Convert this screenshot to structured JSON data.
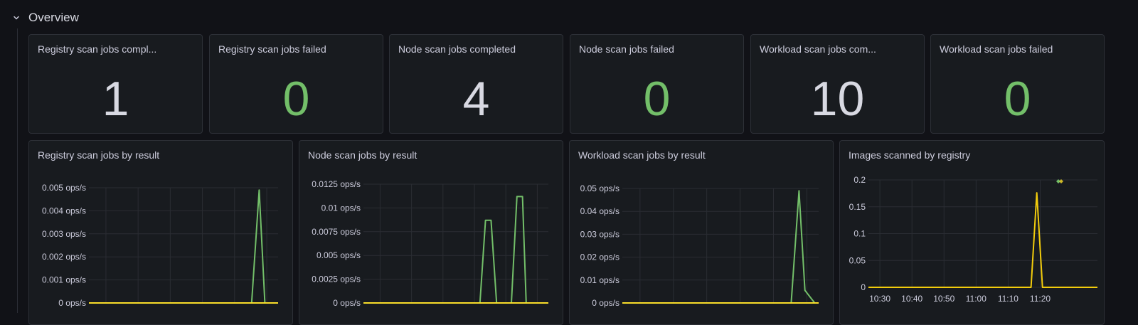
{
  "row": {
    "title": "Overview",
    "icon": "chevron-down-icon"
  },
  "stats": [
    {
      "title": "Registry scan jobs compl...",
      "value": "1",
      "color": "#d8d9e2"
    },
    {
      "title": "Registry scan jobs failed",
      "value": "0",
      "color": "#73bf69"
    },
    {
      "title": "Node scan jobs completed",
      "value": "4",
      "color": "#d8d9e2"
    },
    {
      "title": "Node scan jobs failed",
      "value": "0",
      "color": "#73bf69"
    },
    {
      "title": "Workload scan jobs com...",
      "value": "10",
      "color": "#d8d9e2"
    },
    {
      "title": "Workload scan jobs failed",
      "value": "0",
      "color": "#73bf69"
    }
  ],
  "chart_data": [
    {
      "type": "line",
      "title": "Registry scan jobs by result",
      "y_ticks": [
        "0 ops/s",
        "0.001 ops/s",
        "0.002 ops/s",
        "0.003 ops/s",
        "0.004 ops/s",
        "0.005 ops/s"
      ],
      "ylim": [
        0,
        0.005
      ],
      "x": [
        0,
        0.86,
        0.9,
        0.93,
        1
      ],
      "series": [
        {
          "color": "#73bf69",
          "values": [
            0,
            0,
            0.0049,
            0,
            0
          ]
        },
        {
          "color": "#fade2a",
          "values": [
            0,
            0,
            0,
            0,
            0
          ]
        }
      ]
    },
    {
      "type": "line",
      "title": "Node scan jobs by result",
      "y_ticks": [
        "0 ops/s",
        "0.0025 ops/s",
        "0.005 ops/s",
        "0.0075 ops/s",
        "0.01 ops/s",
        "0.0125 ops/s"
      ],
      "ylim": [
        0,
        0.0125
      ],
      "x": [
        0,
        0.63,
        0.66,
        0.69,
        0.72,
        0.8,
        0.83,
        0.86,
        0.88,
        1
      ],
      "series": [
        {
          "color": "#73bf69",
          "values": [
            0,
            0,
            0.0087,
            0.0087,
            0,
            0,
            0.0112,
            0.0112,
            0,
            0
          ]
        },
        {
          "color": "#fade2a",
          "values": [
            0,
            0,
            0,
            0,
            0,
            0,
            0,
            0,
            0,
            0
          ]
        }
      ]
    },
    {
      "type": "line",
      "title": "Workload scan jobs by result",
      "y_ticks": [
        "0 ops/s",
        "0.01 ops/s",
        "0.02 ops/s",
        "0.03 ops/s",
        "0.04 ops/s",
        "0.05 ops/s"
      ],
      "ylim": [
        0,
        0.05
      ],
      "x": [
        0,
        0.86,
        0.9,
        0.93,
        0.98,
        1
      ],
      "series": [
        {
          "color": "#73bf69",
          "values": [
            0,
            0,
            0.049,
            0.0055,
            0,
            0
          ]
        },
        {
          "color": "#fade2a",
          "values": [
            0,
            0,
            0,
            0,
            0,
            0
          ]
        }
      ]
    },
    {
      "type": "line",
      "title": "Images scanned by registry",
      "y_ticks": [
        "0",
        "0.05",
        "0.1",
        "0.15",
        "0.2"
      ],
      "ylim": [
        0,
        0.2
      ],
      "x_ticks": [
        "10:30",
        "10:40",
        "10:50",
        "11:00",
        "11:10",
        "11:20"
      ],
      "x_tick_pos": [
        0.05,
        0.19,
        0.33,
        0.47,
        0.61,
        0.75
      ],
      "x": [
        0,
        0.71,
        0.735,
        0.76,
        1
      ],
      "series": [
        {
          "color": "#f2cc0c",
          "values": [
            0,
            0,
            0.176,
            0,
            0
          ]
        }
      ]
    }
  ]
}
